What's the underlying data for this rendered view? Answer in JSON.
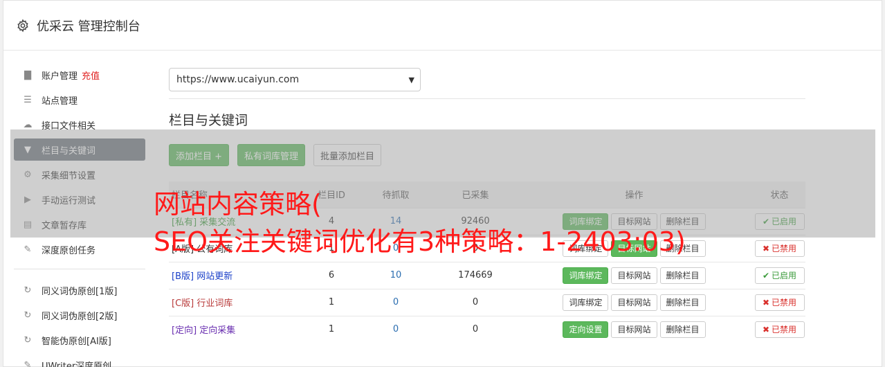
{
  "header": {
    "title": "优采云 管理控制台"
  },
  "sidebar": {
    "items": [
      {
        "label": "账户管理",
        "extra": "充值",
        "icon": "bar-chart-icon"
      },
      {
        "label": "站点管理",
        "icon": "server-icon"
      },
      {
        "label": "接口文件相关",
        "icon": "cloud-upload-icon"
      },
      {
        "label": "栏目与关键词",
        "icon": "filter-icon",
        "active": true
      },
      {
        "label": "采集细节设置",
        "icon": "gears-icon"
      },
      {
        "label": "手动运行测试",
        "icon": "play-icon"
      },
      {
        "label": "文章暂存库",
        "icon": "database-icon"
      },
      {
        "label": "深度原创任务",
        "icon": "edit-icon"
      }
    ],
    "tools": [
      {
        "label": "同义词伪原创[1版]",
        "icon": "refresh-icon"
      },
      {
        "label": "同义词伪原创[2版]",
        "icon": "refresh-icon"
      },
      {
        "label": "智能伪原创[AI版]",
        "icon": "refresh-icon"
      },
      {
        "label": "UWriter深度原创",
        "icon": "edit-icon"
      }
    ]
  },
  "site_select": {
    "value": "https://www.ucaiyun.com"
  },
  "section": {
    "title": "栏目与关键词"
  },
  "buttons": {
    "add_column": "添加栏目 +",
    "private_lib": "私有词库管理",
    "batch_add": "批量添加栏目"
  },
  "table": {
    "headers": [
      "栏目名称",
      "栏目ID",
      "待抓取",
      "已采集",
      "操作",
      "状态"
    ],
    "rows": [
      {
        "tag": "[私有]",
        "name": "采集交流",
        "id": "4",
        "pending": "14",
        "collected": "92460",
        "op1": "词库绑定",
        "op1_green": true,
        "op2": "目标网站",
        "op2_green": false,
        "op3": "删除栏目",
        "status": "已启用",
        "on": true,
        "tag_class": "tag-private"
      },
      {
        "tag": "[A版]",
        "name": "公有词库",
        "id": "1",
        "pending": "0",
        "collected": "0",
        "op1": "词库绑定",
        "op1_green": false,
        "op2": "目标网站",
        "op2_green": true,
        "op3": "删除栏目",
        "status": "已禁用",
        "on": false,
        "tag_class": "tag-a"
      },
      {
        "tag": "[B版]",
        "name": "网站更新",
        "id": "6",
        "pending": "10",
        "collected": "174669",
        "op1": "词库绑定",
        "op1_green": true,
        "op2": "目标网站",
        "op2_green": false,
        "op3": "删除栏目",
        "status": "已启用",
        "on": true,
        "tag_class": "tag-b"
      },
      {
        "tag": "[C版]",
        "name": "行业词库",
        "id": "1",
        "pending": "0",
        "collected": "0",
        "op1": "词库绑定",
        "op1_green": false,
        "op2": "目标网站",
        "op2_green": false,
        "op3": "删除栏目",
        "status": "已禁用",
        "on": false,
        "tag_class": "tag-c"
      },
      {
        "tag": "[定向]",
        "name": "定向采集",
        "id": "1",
        "pending": "0",
        "collected": "0",
        "op1": "定向设置",
        "op1_green": true,
        "op2": "目标网站",
        "op2_green": false,
        "op3": "删除栏目",
        "status": "已禁用",
        "on": false,
        "tag_class": "tag-target"
      }
    ]
  },
  "watermark": {
    "line1": "网站内容策略(",
    "line2": "SEO关注关键词优化有3种策略：1-2403:03)"
  }
}
